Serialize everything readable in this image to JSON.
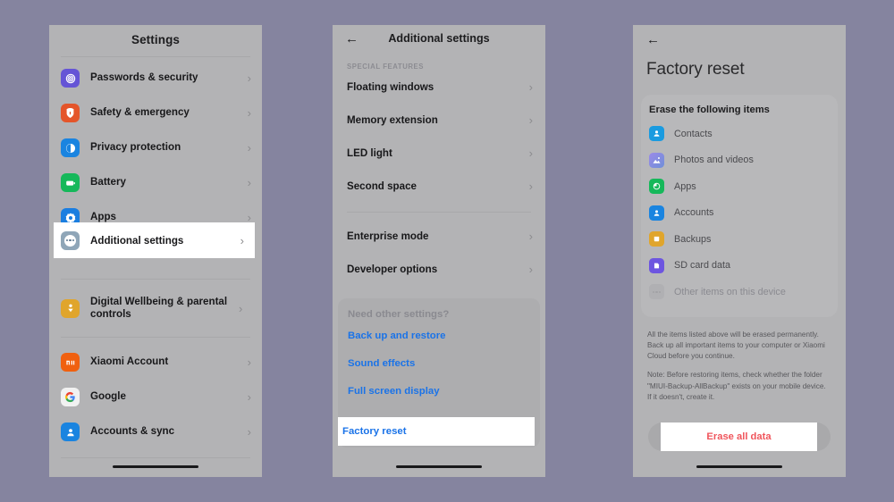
{
  "background_color": "#85849f",
  "panel_background": "#b3b3b5",
  "panels": {
    "settings": {
      "title": "Settings",
      "items": [
        {
          "label": "Passwords & security",
          "icon": "fingerprint-icon",
          "color": "#6554d6"
        },
        {
          "label": "Safety & emergency",
          "icon": "shield-emergency-icon",
          "color": "#e4552a"
        },
        {
          "label": "Privacy protection",
          "icon": "privacy-hand-icon",
          "color": "#1a84e0"
        },
        {
          "label": "Battery",
          "icon": "battery-icon",
          "color": "#16b85a"
        },
        {
          "label": "Apps",
          "icon": "apps-gear-icon",
          "color": "#1a7ee0"
        }
      ],
      "highlighted_item": {
        "label": "Additional settings",
        "icon": "more-dots-icon",
        "color": "#8fa6b8"
      },
      "group2": [
        {
          "label": "Digital Wellbeing & parental controls",
          "icon": "wellbeing-icon",
          "color": "#e0a52c"
        }
      ],
      "group3": [
        {
          "label": "Xiaomi Account",
          "icon": "xiaomi-mi-icon",
          "color": "#f0600f"
        },
        {
          "label": "Google",
          "icon": "google-g-icon",
          "color": "#f1f1f1"
        },
        {
          "label": "Accounts & sync",
          "icon": "accounts-sync-icon",
          "color": "#1a84e0"
        }
      ],
      "chevron": "›"
    },
    "additional_settings": {
      "back_icon": "←",
      "title": "Additional settings",
      "section_header": "SPECIAL FEATURES",
      "items": [
        {
          "label": "Floating windows"
        },
        {
          "label": "Memory extension"
        },
        {
          "label": "LED light"
        },
        {
          "label": "Second space"
        }
      ],
      "items2": [
        {
          "label": "Enterprise mode"
        },
        {
          "label": "Developer options"
        }
      ],
      "need_other_settings": {
        "question": "Need other settings?",
        "links": [
          {
            "label": "Back up and restore"
          },
          {
            "label": "Sound effects"
          },
          {
            "label": "Full screen display"
          }
        ],
        "highlighted_link": {
          "label": "Factory reset"
        }
      },
      "chevron": "›",
      "link_color": "#1a73e8"
    },
    "factory_reset": {
      "back_icon": "←",
      "title": "Factory reset",
      "card_header": "Erase the following items",
      "items": [
        {
          "label": "Contacts",
          "icon": "contacts-icon",
          "color": "#1a9be0"
        },
        {
          "label": "Photos and videos",
          "icon": "photos-icon",
          "color": "#8e7ae0"
        },
        {
          "label": "Apps",
          "icon": "apps-pie-icon",
          "color": "#16b85a"
        },
        {
          "label": "Accounts",
          "icon": "accounts-icon",
          "color": "#1a84e0"
        },
        {
          "label": "Backups",
          "icon": "backups-icon",
          "color": "#e0a52c"
        },
        {
          "label": "SD card data",
          "icon": "sd-card-icon",
          "color": "#6d55e0"
        },
        {
          "label": "Other items on this device",
          "icon": "other-items-icon",
          "color": "#b0b0b3",
          "dimmed": true
        }
      ],
      "fine_print": [
        "All the items listed above will be erased permanently. Back up all important items to your computer or Xiaomi Cloud before you continue.",
        "Note: Before restoring items, check whether the folder \"MIUI-Backup-AllBackup\" exists on your mobile device. If it doesn't, create it."
      ],
      "erase_button": {
        "label": "Erase all data",
        "color": "#f0555c"
      }
    }
  }
}
